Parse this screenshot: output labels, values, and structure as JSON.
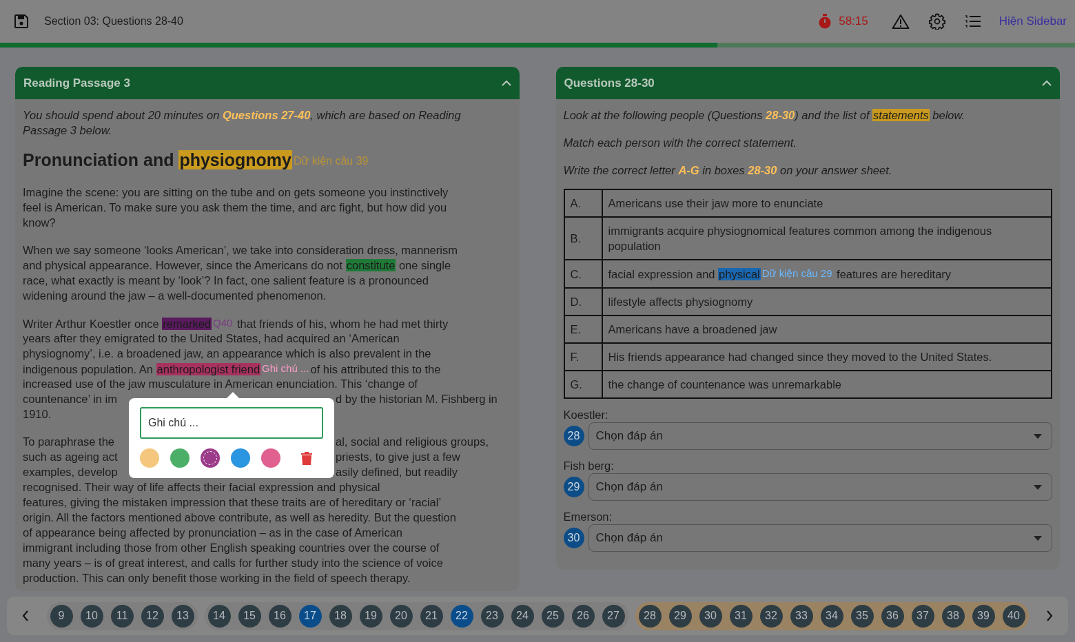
{
  "top_bar": {
    "title": "Section 03: Questions 28-40",
    "timer": "58:15",
    "sidebar_link": "Hiện Sidebar"
  },
  "progress": {
    "level": 0.667
  },
  "passage": {
    "title": "Reading Passage 3",
    "intro": [
      [
        {
          "kind": "text",
          "text": "You should spend about 20 minutes on "
        },
        {
          "kind": "accent",
          "text": "Questions 27-40"
        },
        {
          "kind": "text",
          "text": ", which are based on Reading"
        }
      ],
      [
        {
          "kind": "text",
          "text": "Passage 3 below."
        }
      ]
    ],
    "heading": [
      {
        "kind": "text",
        "text": "Pronunciation and "
      },
      {
        "kind": "mark",
        "text": "physiognomy",
        "color": "#c99a1e"
      },
      {
        "kind": "note",
        "text": "Dữ kiện câu 39",
        "color": "#b8933a"
      }
    ],
    "paragraphs": [
      [
        {
          "kind": "full",
          "segs": [
            {
              "kind": "text",
              "text": "Imagine the scene: you are sitting on the tube and on gets someone you instinctively"
            }
          ]
        },
        {
          "kind": "full",
          "segs": [
            {
              "kind": "text",
              "text": "feel is American. To make sure you ask them the time, and arc fight, but how did you"
            }
          ]
        },
        {
          "kind": "full",
          "segs": [
            {
              "kind": "text",
              "text": "know?"
            }
          ]
        }
      ],
      [
        {
          "kind": "full",
          "segs": [
            {
              "kind": "text",
              "text": "When we say someone ‘looks American’, we take into consideration dress, mannerism"
            }
          ]
        },
        {
          "kind": "full",
          "segs": [
            {
              "kind": "text",
              "text": "and physical appearance. However, since the Americans do not "
            },
            {
              "kind": "mark",
              "text": "constitute",
              "color": "#1f7a38"
            },
            {
              "kind": "text",
              "text": " one single"
            }
          ]
        },
        {
          "kind": "full",
          "segs": [
            {
              "kind": "text",
              "text": "race, what exactly is meant by ‘look’? In fact, one salient feature is a pronounced"
            }
          ]
        },
        {
          "kind": "full",
          "segs": [
            {
              "kind": "text",
              "text": "widening around the jaw – a well-documented phenomenon."
            }
          ]
        }
      ],
      [
        {
          "kind": "full",
          "segs": [
            {
              "kind": "text",
              "text": "Writer Arthur Koestler once "
            },
            {
              "kind": "mark",
              "text": "remarked",
              "color": "#5a1a5e"
            },
            {
              "kind": "note",
              "text": "Q40",
              "color": "#7a3c84"
            },
            {
              "kind": "text",
              "text": " that friends of his, whom he had met thirty"
            }
          ]
        },
        {
          "kind": "full",
          "segs": [
            {
              "kind": "text",
              "text": "years after they emigrated to the United States, had acquired an ‘American"
            }
          ]
        },
        {
          "kind": "full",
          "segs": [
            {
              "kind": "text",
              "text": "physiognomy’, i.e. a broadened jaw, an appearance which is also prevalent in the"
            }
          ]
        },
        {
          "kind": "full",
          "segs": [
            {
              "kind": "text",
              "text": "indigenous population. An "
            },
            {
              "kind": "mark",
              "text": "anthropologist friend",
              "color": "#a8325f"
            },
            {
              "kind": "note",
              "text": "Ghi chú ...",
              "color": "#ff9cc8",
              "popup": {
                "placeholder": "Ghi chú ...",
                "colors": [
                  {
                    "color": "#f5c77e",
                    "selected": false
                  },
                  {
                    "color": "#4caf68",
                    "selected": false
                  },
                  {
                    "color": "#9c3b8a",
                    "selected": true
                  },
                  {
                    "color": "#2a95e0",
                    "selected": false
                  },
                  {
                    "color": "#e0608f",
                    "selected": false
                  }
                ]
              }
            },
            {
              "kind": "text",
              "text": "of his attributed this to the"
            }
          ]
        },
        {
          "kind": "full",
          "segs": [
            {
              "kind": "text",
              "text": "increased use of the jaw musculature in American enunciation. This ‘change of"
            }
          ]
        },
        {
          "kind": "split",
          "left": "countenance’ in im",
          "right": "d by the historian M. Fishberg in"
        },
        {
          "kind": "full",
          "segs": [
            {
              "kind": "text",
              "text": "1910."
            }
          ]
        }
      ],
      [
        {
          "kind": "split",
          "left": "To paraphrase the",
          "right": "al, social and religious groups,"
        },
        {
          "kind": "split",
          "left": "such as ageing act",
          "right": "priests, to give just a few"
        },
        {
          "kind": "split",
          "left": "examples, develop",
          "right": "asily defined, but readily"
        },
        {
          "kind": "full",
          "segs": [
            {
              "kind": "text",
              "text": "recognised. Their way of life affects their facial expression and physical"
            }
          ]
        },
        {
          "kind": "full",
          "segs": [
            {
              "kind": "text",
              "text": "features, giving the mistaken impression that these traits are of hereditary or ‘racial’"
            }
          ]
        },
        {
          "kind": "full",
          "segs": [
            {
              "kind": "text",
              "text": "origin. All the factors mentioned above contribute, as well as heredity. But the question"
            }
          ]
        },
        {
          "kind": "full",
          "segs": [
            {
              "kind": "text",
              "text": "of appearance being affected by pronunciation – as in the case of American"
            }
          ]
        },
        {
          "kind": "full",
          "segs": [
            {
              "kind": "text",
              "text": "immigrant including those from other English speaking countries over the course of"
            }
          ]
        },
        {
          "kind": "full",
          "segs": [
            {
              "kind": "text",
              "text": "many years – is of great interest, and calls for further study into the science of voice"
            }
          ]
        },
        {
          "kind": "full",
          "segs": [
            {
              "kind": "text",
              "text": "production. This can only benefit those working in the field of speech therapy."
            }
          ]
        }
      ]
    ]
  },
  "questions": {
    "title": "Questions 28-30",
    "instructions": [
      [
        {
          "kind": "text",
          "text": "Look at the following people (Questions "
        },
        {
          "kind": "accent",
          "text": "28-30"
        },
        {
          "kind": "text",
          "text": ") and the list of "
        },
        {
          "kind": "mark",
          "text": "statements",
          "color": "#c99a1e"
        },
        {
          "kind": "text",
          "text": " below."
        }
      ],
      [
        {
          "kind": "text",
          "text": "Match each person with the correct statement."
        }
      ],
      [
        {
          "kind": "text",
          "text": "Write the correct letter "
        },
        {
          "kind": "accent",
          "text": "A-G"
        },
        {
          "kind": "text",
          "text": " in boxes "
        },
        {
          "kind": "accent",
          "text": "28-30"
        },
        {
          "kind": "text",
          "text": " on your answer sheet."
        }
      ]
    ],
    "statements": [
      {
        "letter": "A.",
        "segs": [
          {
            "kind": "text",
            "text": "Americans use their jaw more to enunciate"
          }
        ]
      },
      {
        "letter": "B.",
        "segs": [
          {
            "kind": "text",
            "text": "immigrants acquire physiognomical features common among the indigenous population"
          }
        ]
      },
      {
        "letter": "C.",
        "segs": [
          {
            "kind": "text",
            "text": "facial expression and "
          },
          {
            "kind": "mark",
            "text": "physical",
            "color": "#1a67b0"
          },
          {
            "kind": "note",
            "text": "Dữ kiện câu 29",
            "color": "#6ab8ff"
          },
          {
            "kind": "text",
            "text": " features are hereditary"
          }
        ]
      },
      {
        "letter": "D.",
        "segs": [
          {
            "kind": "text",
            "text": "lifestyle affects physiognomy"
          }
        ]
      },
      {
        "letter": "E.",
        "segs": [
          {
            "kind": "text",
            "text": "Americans have a broadened jaw"
          }
        ]
      },
      {
        "letter": "F.",
        "segs": [
          {
            "kind": "text",
            "text": "His friends appearance had changed since they moved to the United States."
          }
        ]
      },
      {
        "letter": "G.",
        "segs": [
          {
            "kind": "text",
            "text": "the change of countenance was unremarkable"
          }
        ]
      }
    ],
    "answers": [
      {
        "label": "Koestler:",
        "number": "28",
        "value": "Chọn đáp án"
      },
      {
        "label": "Fish berg:",
        "number": "29",
        "value": "Chọn đáp án"
      },
      {
        "label": "Emerson:",
        "number": "30",
        "value": "Chọn đáp án"
      }
    ]
  },
  "navigator": {
    "groups": [
      {
        "kind": "part",
        "items": [
          {
            "label": "9",
            "selected": false
          },
          {
            "label": "10",
            "selected": false
          },
          {
            "label": "11",
            "selected": false
          },
          {
            "label": "12",
            "selected": false
          },
          {
            "label": "13",
            "selected": false
          }
        ]
      },
      {
        "kind": "part",
        "items": [
          {
            "label": "14",
            "selected": false
          },
          {
            "label": "15",
            "selected": false
          },
          {
            "label": "16",
            "selected": false
          },
          {
            "label": "17",
            "selected": true
          },
          {
            "label": "18",
            "selected": false
          },
          {
            "label": "19",
            "selected": false
          },
          {
            "label": "20",
            "selected": false
          },
          {
            "label": "21",
            "selected": false
          },
          {
            "label": "22",
            "selected": true
          },
          {
            "label": "23",
            "selected": false
          },
          {
            "label": "24",
            "selected": false
          },
          {
            "label": "25",
            "selected": false
          },
          {
            "label": "26",
            "selected": false
          },
          {
            "label": "27",
            "selected": false
          }
        ]
      },
      {
        "kind": "current",
        "items": [
          {
            "label": "28",
            "selected": false
          },
          {
            "label": "29",
            "selected": false
          },
          {
            "label": "30",
            "selected": false
          },
          {
            "label": "31",
            "selected": false
          },
          {
            "label": "32",
            "selected": false
          },
          {
            "label": "33",
            "selected": false
          },
          {
            "label": "34",
            "selected": false
          },
          {
            "label": "35",
            "selected": false
          },
          {
            "label": "36",
            "selected": false
          },
          {
            "label": "37",
            "selected": false
          },
          {
            "label": "38",
            "selected": false
          },
          {
            "label": "39",
            "selected": false
          },
          {
            "label": "40",
            "selected": false
          }
        ]
      }
    ]
  }
}
